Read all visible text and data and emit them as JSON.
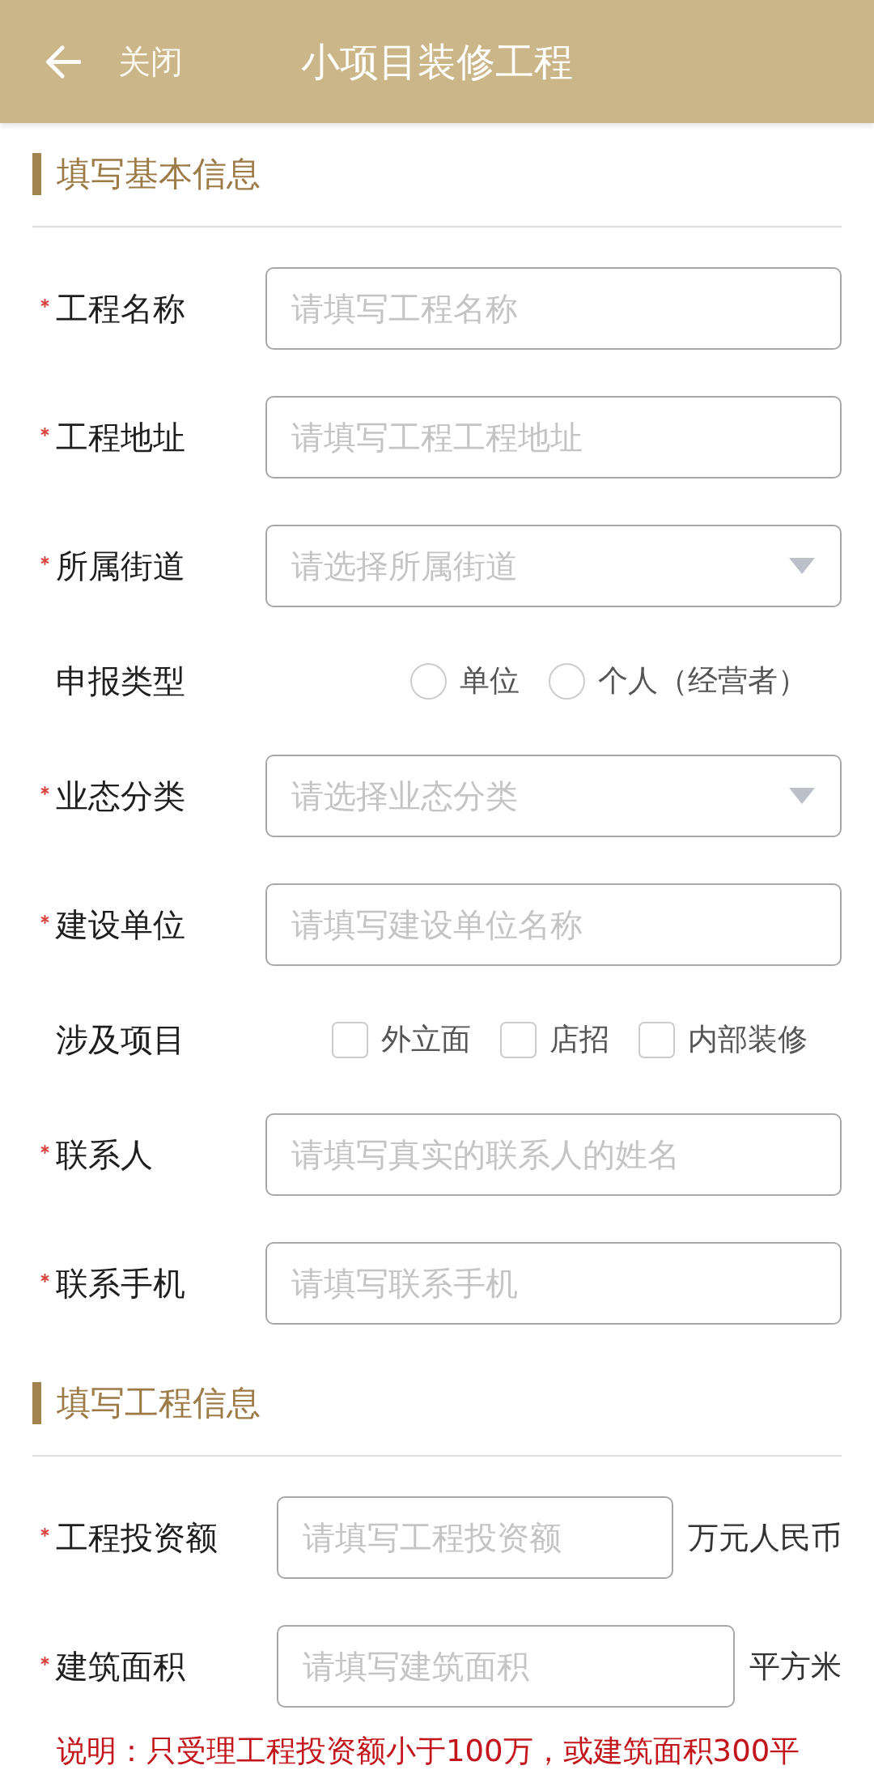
{
  "header": {
    "back_label": "关闭",
    "title": "小项目装修工程"
  },
  "sections": [
    {
      "title": "填写基本信息",
      "fields": [
        {
          "kind": "text",
          "label": "工程名称",
          "required": true,
          "placeholder": "请填写工程名称"
        },
        {
          "kind": "text",
          "label": "工程地址",
          "required": true,
          "placeholder": "请填写工程工程地址"
        },
        {
          "kind": "select",
          "label": "所属街道",
          "required": true,
          "placeholder": "请选择所属街道"
        },
        {
          "kind": "radio",
          "label": "申报类型",
          "required": false,
          "options": [
            {
              "label": "单位",
              "selected": false
            },
            {
              "label": "个人（经营者）",
              "selected": false
            }
          ]
        },
        {
          "kind": "select",
          "label": "业态分类",
          "required": true,
          "placeholder": "请选择业态分类"
        },
        {
          "kind": "text",
          "label": "建设单位",
          "required": true,
          "placeholder": "请填写建设单位名称"
        },
        {
          "kind": "checkbox",
          "label": "涉及项目",
          "required": false,
          "options": [
            {
              "label": "外立面",
              "checked": false
            },
            {
              "label": "店招",
              "checked": false
            },
            {
              "label": "内部装修",
              "checked": false
            }
          ]
        },
        {
          "kind": "text",
          "label": "联系人",
          "required": true,
          "placeholder": "请填写真实的联系人的姓名"
        },
        {
          "kind": "text",
          "label": "联系手机",
          "required": true,
          "placeholder": "请填写联系手机"
        }
      ]
    },
    {
      "title": "填写工程信息",
      "fields": [
        {
          "kind": "text",
          "label": "工程投资额",
          "required": true,
          "placeholder": "请填写工程投资额",
          "unit": "万元人民币"
        },
        {
          "kind": "text",
          "label": "建筑面积",
          "required": true,
          "placeholder": "请填写建筑面积",
          "unit": "平方米"
        }
      ],
      "note": "说明：只受理工程投资额小于100万，或建筑面积300平"
    }
  ]
}
